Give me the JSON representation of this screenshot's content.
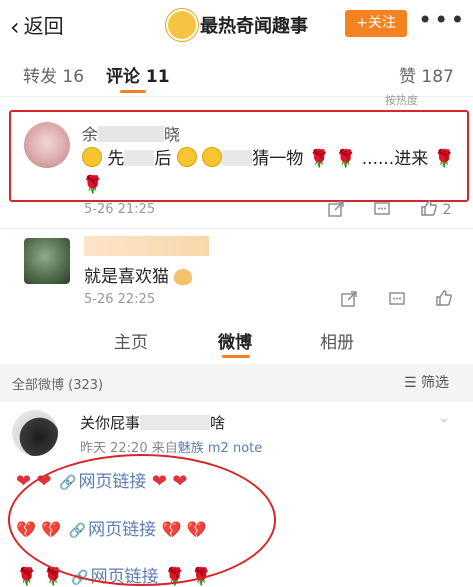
{
  "header": {
    "back_label": "返回",
    "title": "最热奇闻趣事",
    "follow_label": "+关注",
    "more_label": "•••"
  },
  "comment_tabs": {
    "repost": "转发 16",
    "comment": "评论 11",
    "like": "赞 187",
    "sort_hint": "按热度"
  },
  "comments": [
    {
      "name_prefix": "余",
      "name_suffix": "晓",
      "text_parts": [
        "先",
        "后",
        "猜一物",
        "......进来"
      ],
      "date": "5-26 21:25",
      "like_count": "2"
    },
    {
      "text": "就是喜欢猫",
      "date": "5-26 22:25"
    }
  ],
  "profile_tabs": {
    "home": "主页",
    "weibo": "微博",
    "album": "相册"
  },
  "filter_bar": {
    "all_label": "全部微博 (323)",
    "filter_label": "筛选"
  },
  "post": {
    "name_prefix": "关你屁事",
    "name_suffix": "啥",
    "time": "昨天 22:20",
    "source_prefix": "来自",
    "source": "魅族 m2 note",
    "link_label": "网页链接"
  },
  "icons": {
    "back": "chevron-left-icon",
    "rose": "rose-emoji",
    "heart": "heart-emoji",
    "broken_heart": "broken-heart-emoji",
    "link": "link-icon",
    "share": "share-icon",
    "comment": "comment-icon",
    "like": "thumbs-up-icon",
    "filter": "filter-icon"
  },
  "colors": {
    "accent": "#f58220",
    "highlight": "#d6262c",
    "link": "#5b7db5"
  }
}
